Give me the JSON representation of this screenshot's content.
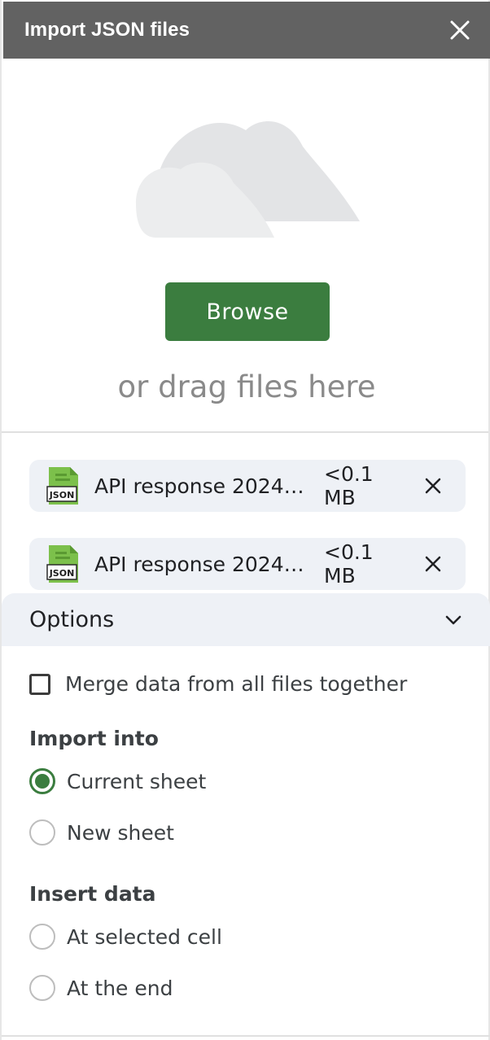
{
  "dialog": {
    "title": "Import JSON files"
  },
  "dropzone": {
    "browse_label": "Browse",
    "drag_text": "or drag files here"
  },
  "files": [
    {
      "name": "API response 2024-...",
      "size": "<0.1 MB",
      "icon_label": "JSON"
    },
    {
      "name": "API response 2024-...",
      "size": "<0.1 MB",
      "icon_label": "JSON"
    }
  ],
  "options": {
    "header_label": "Options",
    "merge_label": "Merge data from all files together",
    "merge_checked": false,
    "import_into": {
      "label": "Import into",
      "choices": [
        "Current sheet",
        "New sheet"
      ],
      "selected": "Current sheet"
    },
    "insert_data": {
      "label": "Insert data",
      "choices": [
        "At selected cell",
        "At the end"
      ],
      "selected": null
    }
  },
  "colors": {
    "titlebar": "#626262",
    "accent_green": "#3b7d3f",
    "file_row_bg": "#eef1f6",
    "cloud": "#e3e4e6"
  }
}
